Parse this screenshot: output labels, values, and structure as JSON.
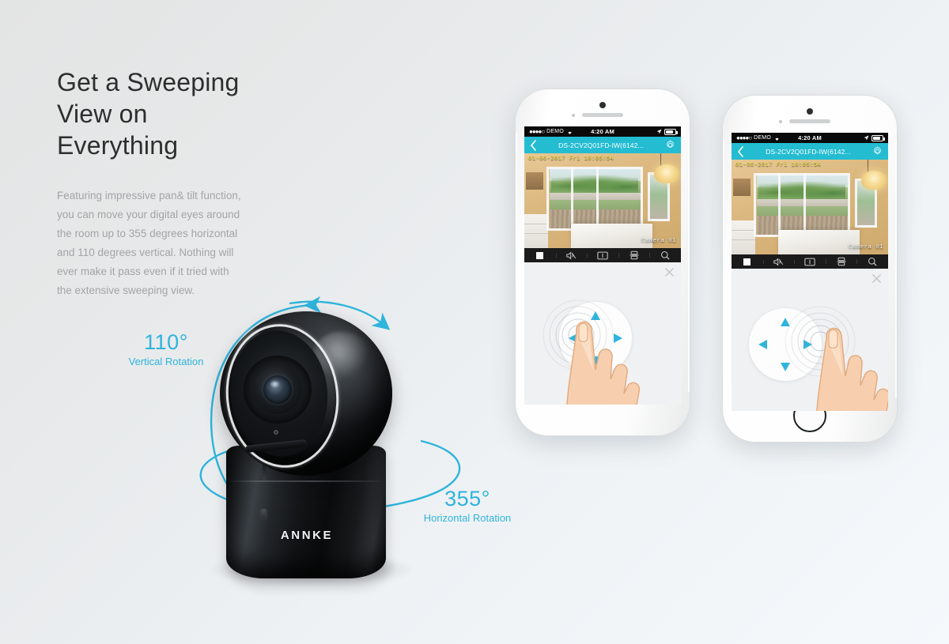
{
  "page": {
    "background_top": "#e3e4e4",
    "background_bottom": "#f5f9fc",
    "accent_color": "#2fb4dc"
  },
  "copy": {
    "headline_line1": "Get a Sweeping",
    "headline_line2": "View on",
    "headline_line3": "Everything",
    "paragraph_lines": [
      "Featuring impressive pan& tilt function,",
      "you can move your digital eyes around",
      "the room up to 355 degrees horizontal",
      "and 110 degrees vertical. Nothing will",
      "ever make it pass even if it tried with",
      "the extensive sweeping view."
    ]
  },
  "callouts": {
    "vertical": {
      "degrees": "110°",
      "caption": "Vertical Rotation"
    },
    "horizontal": {
      "degrees": "355°",
      "caption": "Horizontal Rotation"
    }
  },
  "camera": {
    "brand": "ANNKE",
    "dome_color": "#0d0f11",
    "ring_color": "#f5f8fa"
  },
  "phones": [
    {
      "id": "phone-left",
      "statusbar": {
        "carrier": "DEMO",
        "signal_dots": "●●●●○",
        "wifi_icon": "wifi-icon",
        "time": "4:20 AM",
        "location_icon": "location-arrow-icon",
        "battery_icon": "battery-icon"
      },
      "navbar": {
        "back_icon": "chevron-left-icon",
        "title": "DS-2CV2Q01FD-IW(6142...",
        "settings_icon": "gear-icon",
        "color": "#24bcd1"
      },
      "video": {
        "timestamp": "01-06-2017 Fri 10:05:54",
        "camera_label": "Camera 01"
      },
      "toolbar": [
        {
          "name": "stop-button",
          "icon": "stop-square-icon"
        },
        {
          "name": "mute-button",
          "icon": "speaker-mute-icon"
        },
        {
          "name": "snapshot-button",
          "icon": "snapshot-icon"
        },
        {
          "name": "record-button",
          "icon": "record-layout-icon"
        },
        {
          "name": "zoom-button",
          "icon": "magnifier-icon"
        }
      ],
      "lower_panel": {
        "close_icon": "close-x-icon",
        "ptz": {
          "up_arrow": "triangle-up-icon",
          "down_arrow": "triangle-down-icon",
          "left_arrow": "triangle-left-icon",
          "right_arrow": "triangle-right-icon",
          "active_direction": "left",
          "hand_icon": "pointing-hand-icon"
        }
      }
    },
    {
      "id": "phone-right",
      "statusbar": {
        "carrier": "DEMO",
        "signal_dots": "●●●●○",
        "wifi_icon": "wifi-icon",
        "time": "4:20 AM",
        "location_icon": "location-arrow-icon",
        "battery_icon": "battery-icon"
      },
      "navbar": {
        "back_icon": "chevron-left-icon",
        "title": "DS-2CV2Q01FD-IW(6142...",
        "settings_icon": "gear-icon",
        "color": "#24bcd1"
      },
      "video": {
        "timestamp": "01-06-2017 Fri 10:05:54",
        "camera_label": "Camera 01"
      },
      "toolbar": [
        {
          "name": "stop-button",
          "icon": "stop-square-icon"
        },
        {
          "name": "mute-button",
          "icon": "speaker-mute-icon"
        },
        {
          "name": "snapshot-button",
          "icon": "snapshot-icon"
        },
        {
          "name": "record-button",
          "icon": "record-layout-icon"
        },
        {
          "name": "zoom-button",
          "icon": "magnifier-icon"
        }
      ],
      "lower_panel": {
        "close_icon": "close-x-icon",
        "ptz": {
          "up_arrow": "triangle-up-icon",
          "down_arrow": "triangle-down-icon",
          "left_arrow": "triangle-left-icon",
          "right_arrow": "triangle-right-icon",
          "active_direction": "right",
          "hand_icon": "pointing-hand-icon"
        }
      },
      "home_button": "home-button"
    }
  ]
}
